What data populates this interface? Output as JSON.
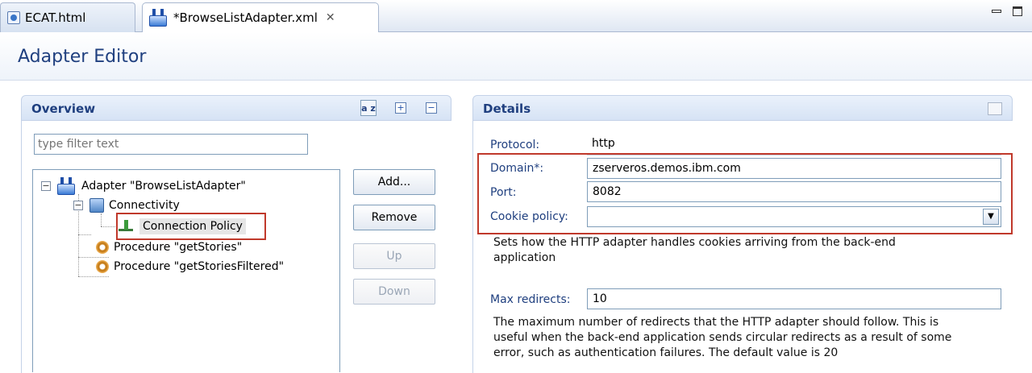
{
  "tabs": [
    {
      "label": "ECAT.html"
    },
    {
      "label": "*BrowseListAdapter.xml",
      "close": "✕"
    }
  ],
  "editor": {
    "title": "Adapter Editor"
  },
  "overview": {
    "title": "Overview",
    "sort_glyph": "a z",
    "filter_placeholder": "type filter text",
    "tree": {
      "adapter": "Adapter \"BrowseListAdapter\"",
      "connectivity": "Connectivity",
      "connection_policy": "Connection Policy",
      "procedure1": "Procedure \"getStories\"",
      "procedure2": "Procedure \"getStoriesFiltered\""
    },
    "buttons": {
      "add": "Add...",
      "remove": "Remove",
      "up": "Up",
      "down": "Down"
    }
  },
  "details": {
    "title": "Details",
    "protocol_label": "Protocol:",
    "protocol_value": "http",
    "domain_label": "Domain*:",
    "domain_value": "zserveros.demos.ibm.com",
    "port_label": "Port:",
    "port_value": "8082",
    "cookie_label": "Cookie policy:",
    "cookie_value": "",
    "cookie_help_1": "Sets how the HTTP adapter handles cookies arriving from the back-end",
    "cookie_help_2": "application",
    "maxredir_label": "Max redirects:",
    "maxredir_value": "10",
    "maxredir_help_1": "The maximum number of redirects that the HTTP adapter should follow. This is",
    "maxredir_help_2": "useful when the back-end application sends circular redirects as a result of some",
    "maxredir_help_3": "error, such as authentication failures. The default value is 20"
  },
  "colors": {
    "accent": "#1f3f7f",
    "highlight": "#c0392b"
  }
}
